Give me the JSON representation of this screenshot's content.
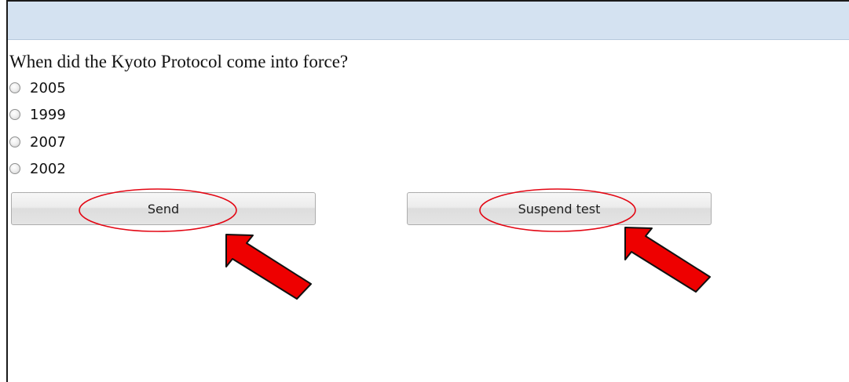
{
  "question": {
    "text": "When did the Kyoto Protocol come into force?"
  },
  "options": [
    {
      "label": "2005",
      "selected": false
    },
    {
      "label": "1999",
      "selected": false
    },
    {
      "label": "2007",
      "selected": false
    },
    {
      "label": "2002",
      "selected": false
    }
  ],
  "buttons": {
    "send_label": "Send",
    "suspend_label": "Suspend test"
  },
  "colors": {
    "header_bar": "#d4e2f1",
    "annotation_red": "#e30613"
  },
  "annotations": {
    "icons": [
      "ellipse-highlight",
      "arrow-icon"
    ]
  }
}
